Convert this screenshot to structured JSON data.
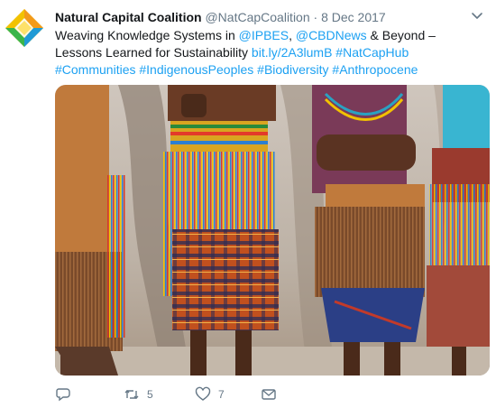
{
  "colors": {
    "link": "#1da1f2",
    "muted": "#657786",
    "text": "#14171a"
  },
  "author": {
    "name": "Natural Capital Coalition",
    "handle": "@NatCapCoalition",
    "separator": "·",
    "date": "8 Dec 2017",
    "avatar_icon": "diamond-logo-icon"
  },
  "tweet": {
    "t1": "Weaving Knowledge Systems in ",
    "m1": "@IPBES",
    "t2": ", ",
    "m2": "@CBDNews",
    "t3": " & Beyond – Lessons Learned for Sustainability ",
    "url": "bit.ly/2A3lumB",
    "t4": " ",
    "h1": "#NatCapHub",
    "t5": " ",
    "h2": "#Communities",
    "t6": " ",
    "h3": "#IndigenousPeoples",
    "t7": " ",
    "h4": "#Biodiversity",
    "t8": " ",
    "h5": "#Anthropocene"
  },
  "actions": {
    "reply_icon": "reply-icon",
    "retweet_icon": "retweet-icon",
    "retweet_count": "5",
    "like_icon": "heart-icon",
    "like_count": "7",
    "dm_icon": "mail-icon"
  }
}
